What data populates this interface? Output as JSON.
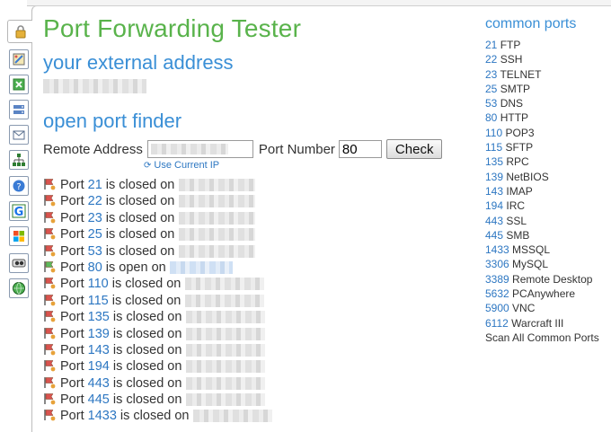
{
  "page_title": "Port Forwarding Tester",
  "external_heading": "your external address",
  "finder_heading": "open port finder",
  "form": {
    "remote_label": "Remote Address",
    "remote_value": "",
    "port_label": "Port Number",
    "port_value": "80",
    "check_label": "Check",
    "use_ip_label": "Use Current IP"
  },
  "results": [
    {
      "prefix": "Port ",
      "port": "21",
      "status": " is closed on",
      "open": false
    },
    {
      "prefix": "Port ",
      "port": "22",
      "status": " is closed on",
      "open": false
    },
    {
      "prefix": "Port ",
      "port": "23",
      "status": " is closed on",
      "open": false
    },
    {
      "prefix": "Port ",
      "port": "25",
      "status": " is closed on",
      "open": false
    },
    {
      "prefix": "Port ",
      "port": "53",
      "status": " is closed on",
      "open": false
    },
    {
      "prefix": "Port ",
      "port": "80",
      "status": " is open on",
      "open": true
    },
    {
      "prefix": "Port ",
      "port": "110",
      "status": " is closed on",
      "open": false
    },
    {
      "prefix": "Port ",
      "port": "115",
      "status": " is closed on",
      "open": false
    },
    {
      "prefix": "Port ",
      "port": "135",
      "status": " is closed on",
      "open": false
    },
    {
      "prefix": "Port ",
      "port": "139",
      "status": " is closed on",
      "open": false
    },
    {
      "prefix": "Port ",
      "port": "143",
      "status": " is closed on",
      "open": false
    },
    {
      "prefix": "Port ",
      "port": "194",
      "status": " is closed on",
      "open": false
    },
    {
      "prefix": "Port ",
      "port": "443",
      "status": " is closed on",
      "open": false
    },
    {
      "prefix": "Port ",
      "port": "445",
      "status": " is closed on",
      "open": false
    },
    {
      "prefix": "Port ",
      "port": "1433",
      "status": " is closed on",
      "open": false
    }
  ],
  "common_ports": {
    "title": "common ports",
    "items": [
      {
        "port": "21",
        "name": " FTP"
      },
      {
        "port": "22",
        "name": " SSH"
      },
      {
        "port": "23",
        "name": " TELNET"
      },
      {
        "port": "25",
        "name": " SMTP"
      },
      {
        "port": "53",
        "name": " DNS"
      },
      {
        "port": "80",
        "name": " HTTP"
      },
      {
        "port": "110",
        "name": " POP3"
      },
      {
        "port": "115",
        "name": " SFTP"
      },
      {
        "port": "135",
        "name": " RPC"
      },
      {
        "port": "139",
        "name": " NetBIOS"
      },
      {
        "port": "143",
        "name": " IMAP"
      },
      {
        "port": "194",
        "name": " IRC"
      },
      {
        "port": "443",
        "name": " SSL"
      },
      {
        "port": "445",
        "name": " SMB"
      },
      {
        "port": "1433",
        "name": " MSSQL"
      },
      {
        "port": "3306",
        "name": " MySQL"
      },
      {
        "port": "3389",
        "name": " Remote Desktop"
      },
      {
        "port": "5632",
        "name": " PCAnywhere"
      },
      {
        "port": "5900",
        "name": " VNC"
      },
      {
        "port": "6112",
        "name": " Warcraft III"
      }
    ],
    "scan_all": "Scan All Common Ports"
  },
  "colors": {
    "title_green": "#59b34b",
    "heading_blue": "#3a8fd6",
    "link_blue": "#2d77c2",
    "closed_flag": "#d9534f",
    "open_flag": "#5cb85c"
  },
  "sidebar_icons": [
    "lock-icon",
    "paint-icon",
    "spreadsheet-icon",
    "server-icon",
    "mail-icon",
    "network-icon",
    "help-icon",
    "google-icon",
    "windows-icon",
    "webcam-icon",
    "globe-icon"
  ]
}
